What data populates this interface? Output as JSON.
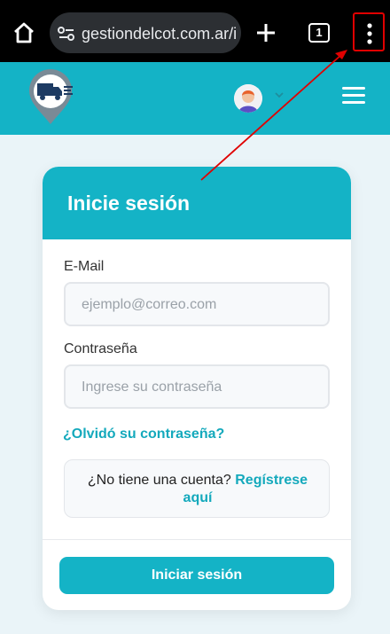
{
  "browser": {
    "url": "gestiondelcot.com.ar/ii",
    "tab_count": "1"
  },
  "login": {
    "title": "Inicie sesión",
    "email_label": "E-Mail",
    "email_placeholder": "ejemplo@correo.com",
    "password_label": "Contraseña",
    "password_placeholder": "Ingrese su contraseña",
    "forgot_link": "¿Olvidó su contraseña?",
    "register_prompt": "¿No tiene una cuenta?",
    "register_link_part1": "Regístrese",
    "register_link_part2": "aquí",
    "submit_label": "Iniciar sesión"
  },
  "colors": {
    "accent": "#14b3c6",
    "annotation": "#e00000"
  },
  "icons": {
    "home": "home-icon",
    "site_info": "tune-icon",
    "new_tab": "plus-icon",
    "menu": "more-vert-icon",
    "hamburger": "hamburger-icon"
  }
}
